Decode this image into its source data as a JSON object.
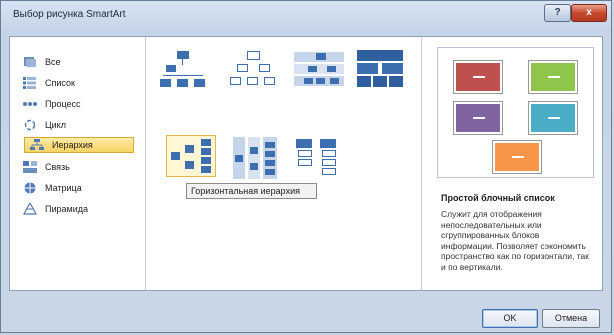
{
  "window": {
    "title": "Выбор рисунка SmartArt",
    "help_label": "?",
    "close_label": "x"
  },
  "categories": [
    {
      "label": "Все",
      "icon": "all-icon"
    },
    {
      "label": "Список",
      "icon": "list-icon"
    },
    {
      "label": "Процесс",
      "icon": "process-icon"
    },
    {
      "label": "Цикл",
      "icon": "cycle-icon"
    },
    {
      "label": "Иерархия",
      "icon": "hierarchy-icon",
      "selected": true
    },
    {
      "label": "Связь",
      "icon": "relationship-icon"
    },
    {
      "label": "Матрица",
      "icon": "matrix-icon"
    },
    {
      "label": "Пирамида",
      "icon": "pyramid-icon"
    }
  ],
  "tooltip": "Горизонтальная иерархия",
  "preview": {
    "title": "Простой блочный список",
    "description": "Служит для отображения непоследовательных или сгруппированных блоков информации. Позволяет сэкономить пространство как по горизонтали, так и по вертикали.",
    "colors": [
      "#c0504d",
      "#8ec54a",
      "#8064a2",
      "#4bacc6",
      "#f79646"
    ]
  },
  "buttons": {
    "ok": "OK",
    "cancel": "Отмена"
  }
}
